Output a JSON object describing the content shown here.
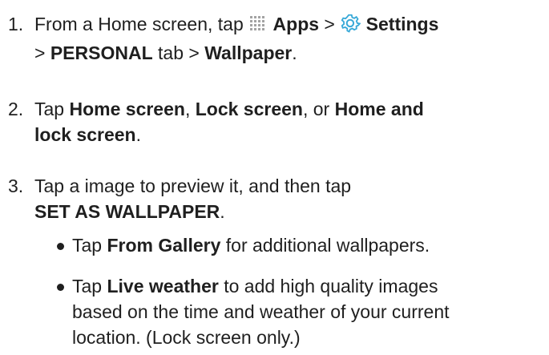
{
  "steps": [
    {
      "number": "1.",
      "t1": "From a Home screen, tap ",
      "apps": "Apps",
      "sep1": " > ",
      "settings": "Settings",
      "line2_sep1": "> ",
      "personal": "PERSONAL",
      "t2": " tab > ",
      "wallpaper": "Wallpaper",
      "t3": "."
    },
    {
      "number": "2.",
      "t1": "Tap ",
      "home": "Home screen",
      "t2": ", ",
      "lock": "Lock screen",
      "t3": ", or ",
      "homelock1": "Home and",
      "homelock2": "lock screen",
      "t4": "."
    },
    {
      "number": "3.",
      "t1": "Tap a image to preview it, and then tap",
      "set": "SET AS WALLPAPER",
      "t2": "."
    }
  ],
  "bullets": [
    {
      "t1": "Tap ",
      "b": "From Gallery",
      "t2": " for additional wallpapers."
    },
    {
      "t1": "Tap ",
      "b": "Live weather",
      "line1_rest": " to add high quality images",
      "line2": "based on the time and weather of your current",
      "line3": "location. (Lock screen only.)"
    }
  ],
  "icons": {
    "apps": "apps-grid-icon",
    "settings": "settings-gear-icon",
    "apps_color": "#a3a3a3",
    "settings_color": "#38a9d8"
  }
}
